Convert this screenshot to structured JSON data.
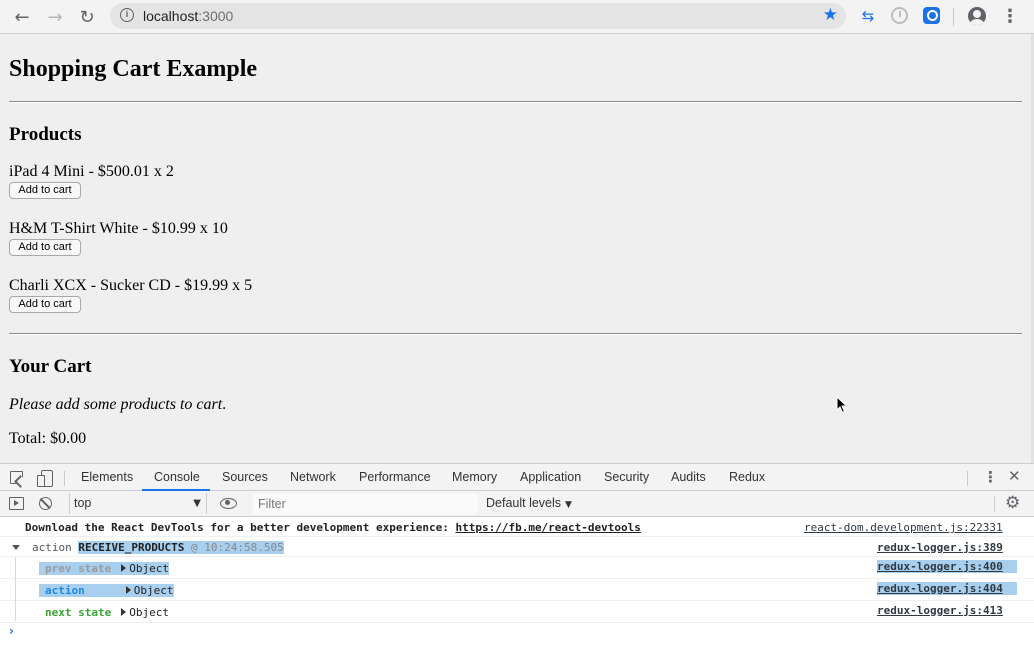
{
  "browser": {
    "url_host": "localhost",
    "url_port": ":3000",
    "back_icon": "←",
    "forward_icon": "→",
    "reload_icon": "↻",
    "star_icon": "★"
  },
  "page": {
    "title": "Shopping Cart Example",
    "products_heading": "Products",
    "products": [
      {
        "label": "iPad 4 Mini - $500.01 x 2",
        "button": "Add to cart"
      },
      {
        "label": "H&M T-Shirt White - $10.99 x 10",
        "button": "Add to cart"
      },
      {
        "label": "Charli XCX - Sucker CD - $19.99 x 5",
        "button": "Add to cart"
      }
    ],
    "cart_heading": "Your Cart",
    "cart_empty": "Please add some products to cart",
    "cart_empty_punct": ".",
    "total": "Total: $0.00"
  },
  "devtools": {
    "tabs": [
      "Elements",
      "Console",
      "Sources",
      "Network",
      "Performance",
      "Memory",
      "Application",
      "Security",
      "Audits",
      "Redux"
    ],
    "active_tab": "Console",
    "context": "top",
    "filter_placeholder": "Filter",
    "levels": "Default levels",
    "console": {
      "msg_text": "Download the React DevTools for a better development experience: ",
      "msg_link": "https://fb.me/react-devtools",
      "msg_src": "react-dom.development.js:22331",
      "group_word": "action",
      "group_action": "RECEIVE_PRODUCTS",
      "group_time": "@ 10:24:58.505",
      "group_src": "redux-logger.js:389",
      "rows": [
        {
          "label": "prev state",
          "value": "Object",
          "src": "redux-logger.js:400"
        },
        {
          "label": "action",
          "value": "Object",
          "src": "redux-logger.js:404"
        },
        {
          "label": "next state",
          "value": "Object",
          "src": "redux-logger.js:413"
        }
      ]
    }
  },
  "colors": {
    "accent": "#1a73e8",
    "highlight": "#a8cfee",
    "prev_state": "#9b9b9b",
    "action": "#1e88e5",
    "next_state": "#3aa335"
  }
}
